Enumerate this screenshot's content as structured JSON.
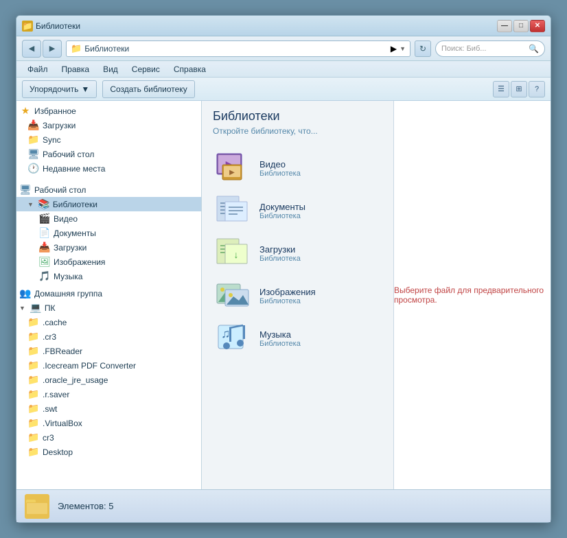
{
  "window": {
    "title": "Библиотеки",
    "controls": {
      "minimize": "—",
      "maximize": "□",
      "close": "✕"
    }
  },
  "addressbar": {
    "folder_icon": "📁",
    "path": "Библиотеки",
    "arrow": "▶",
    "dropdown": "▼",
    "refresh": "↻",
    "search_placeholder": "Поиск: Биб..."
  },
  "menubar": {
    "items": [
      "Файл",
      "Правка",
      "Вид",
      "Сервис",
      "Справка"
    ]
  },
  "toolbar": {
    "organize_label": "Упорядочить",
    "organize_arrow": "▼",
    "create_library_label": "Создать библиотеку"
  },
  "tree": {
    "sections": [
      {
        "label": "Избранное",
        "icon": "★",
        "indent": 0,
        "children": [
          {
            "label": "Загрузки",
            "icon": "📥",
            "indent": 1
          },
          {
            "label": "Sync",
            "icon": "📁",
            "indent": 1
          },
          {
            "label": "Рабочий стол",
            "icon": "🖥",
            "indent": 1
          },
          {
            "label": "Недавние места",
            "icon": "🕐",
            "indent": 1
          }
        ]
      },
      {
        "label": "Рабочий стол",
        "icon": "🖥",
        "indent": 0
      },
      {
        "label": "Библиотеки",
        "icon": "📚",
        "indent": 1,
        "selected": true,
        "children": [
          {
            "label": "Видео",
            "icon": "🎬",
            "indent": 2
          },
          {
            "label": "Документы",
            "icon": "📄",
            "indent": 2
          },
          {
            "label": "Загрузки",
            "icon": "📥",
            "indent": 2
          },
          {
            "label": "Изображения",
            "icon": "🖼",
            "indent": 2
          },
          {
            "label": "Музыка",
            "icon": "🎵",
            "indent": 2
          }
        ]
      },
      {
        "label": "Домашняя группа",
        "icon": "👥",
        "indent": 0
      },
      {
        "label": "ПК",
        "icon": "💻",
        "indent": 0,
        "children": [
          {
            "label": ".cache",
            "icon": "📁",
            "indent": 1
          },
          {
            "label": ".cr3",
            "icon": "📁",
            "indent": 1
          },
          {
            "label": ".FBReader",
            "icon": "📁",
            "indent": 1
          },
          {
            "label": ".Icecream PDF Converter",
            "icon": "📁",
            "indent": 1
          },
          {
            "label": ".oracle_jre_usage",
            "icon": "📁",
            "indent": 1
          },
          {
            "label": ".r.saver",
            "icon": "📁",
            "indent": 1
          },
          {
            "label": ".swt",
            "icon": "📁",
            "indent": 1
          },
          {
            "label": ".VirtualBox",
            "icon": "📁",
            "indent": 1
          },
          {
            "label": "cr3",
            "icon": "📁",
            "indent": 1
          },
          {
            "label": "Desktop",
            "icon": "📁",
            "indent": 1
          }
        ]
      }
    ]
  },
  "libraries": {
    "title": "Библиотеки",
    "subtitle": "Откройте библиотеку, что...",
    "items": [
      {
        "name": "Видео",
        "type": "Библиотека",
        "icon_type": "video"
      },
      {
        "name": "Документы",
        "type": "Библиотека",
        "icon_type": "docs"
      },
      {
        "name": "Загрузки",
        "type": "Библиотека",
        "icon_type": "downloads"
      },
      {
        "name": "Изображения",
        "type": "Библиотека",
        "icon_type": "images"
      },
      {
        "name": "Музыка",
        "type": "Библиотека",
        "icon_type": "music"
      }
    ]
  },
  "preview": {
    "text": "Выберите файл для предварительного просмотра."
  },
  "statusbar": {
    "text": "Элементов: 5"
  }
}
